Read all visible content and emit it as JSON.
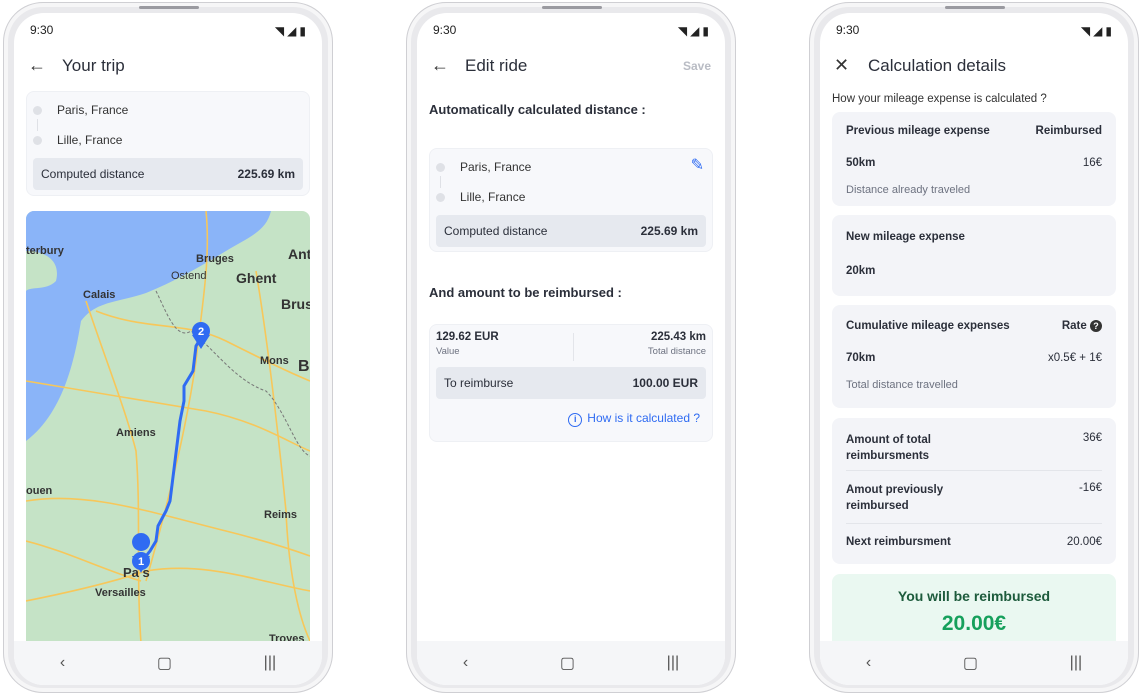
{
  "status": {
    "time": "9:30"
  },
  "screen1": {
    "title": "Your trip",
    "stops": [
      "Paris, France",
      "Lille, France"
    ],
    "computed_label": "Computed distance",
    "computed_value": "225.69 km",
    "map_labels": [
      "terbury",
      "Bruges",
      "Ostend",
      "Ghent",
      "Ant",
      "Calais",
      "Brus",
      "Mons",
      "B",
      "Amiens",
      "ouen",
      "Reims",
      "Pa s",
      "Versailles",
      "Troyes"
    ],
    "markers": [
      "1",
      "2"
    ]
  },
  "screen2": {
    "title": "Edit ride",
    "save": "Save",
    "section1": "Automatically calculated distance :",
    "stops": [
      "Paris, France",
      "Lille, France"
    ],
    "computed_label": "Computed distance",
    "computed_value": "225.69 km",
    "section2": "And amount to be reimbursed :",
    "value_amount": "129.62 EUR",
    "value_label": "Value",
    "distance_amount": "225.43 km",
    "distance_label": "Total distance",
    "reimburse_label": "To reimburse",
    "reimburse_value": "100.00 EUR",
    "help_link": "How is it calculated ?"
  },
  "screen3": {
    "title": "Calculation details",
    "subtitle": "How your mileage expense is calculated ?",
    "previous": {
      "title": "Previous mileage expense",
      "status": "Reimbursed",
      "distance": "50km",
      "amount": "16€",
      "note": "Distance already traveled"
    },
    "new": {
      "title": "New mileage expense",
      "distance": "20km"
    },
    "cumulative": {
      "title": "Cumulative mileage expenses",
      "rate_label": "Rate",
      "distance": "70km",
      "formula": "x0.5€ + 1€",
      "note": "Total distance travelled"
    },
    "summary": [
      {
        "label": "Amount of total reimbursments",
        "value": "36€"
      },
      {
        "label": "Amout previously reimbursed",
        "value": "-16€"
      },
      {
        "label": "Next reimbursment",
        "value": "20.00€"
      }
    ],
    "result_label": "You will be reimbursed",
    "result_value": "20.00€"
  },
  "colors": {
    "accent": "#2f6bf2",
    "green": "#16a05c",
    "map_land": "#c5e3c6",
    "map_sea": "#8ab4f8",
    "road": "#f7c75a"
  }
}
